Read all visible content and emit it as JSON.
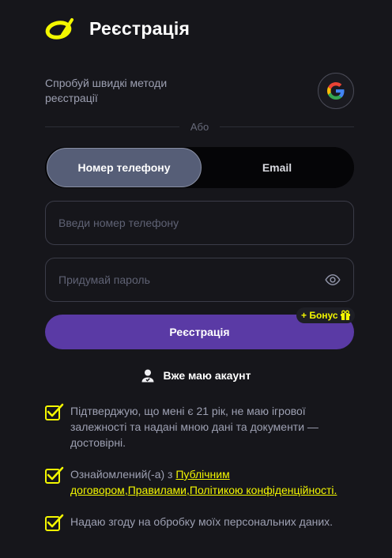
{
  "header": {
    "title": "Реєстрація",
    "logo_icon": "brand-logo-icon"
  },
  "quick_methods": {
    "text": "Спробуй швидкі методи реєстрації",
    "google_icon": "google-icon"
  },
  "divider": {
    "label": "Або"
  },
  "tabs": [
    {
      "label": "Номер телефону",
      "active": true
    },
    {
      "label": "Email",
      "active": false
    }
  ],
  "form": {
    "phone": {
      "value": "",
      "placeholder": "Введи номер телефону"
    },
    "password": {
      "value": "",
      "placeholder": "Придумай пароль"
    },
    "submit_label": "Реєстрація",
    "bonus_label": "+ Бонус"
  },
  "login_link": {
    "label": "Вже маю акаунт"
  },
  "consents": {
    "age": {
      "text": "Підтверджую, що мені є 21 рік, не маю ігрової залежності та надані мною дані та документи — достовірні.",
      "checked": true
    },
    "terms": {
      "prefix": "Ознайомлений(-а) з ",
      "link1": "Публічним договором",
      "sep1": ",",
      "link2": "Правилами",
      "sep2": ",",
      "link3": "Політикою конфіденційності",
      "suffix": ".",
      "checked": true
    },
    "personal": {
      "text": "Надаю згоду на обробку моїх персональних даних.",
      "checked": true
    }
  },
  "colors": {
    "background": "#16161b",
    "accent_yellow": "#f3f700",
    "button_purple": "#5a3aa5",
    "active_tab": "#565e77"
  }
}
